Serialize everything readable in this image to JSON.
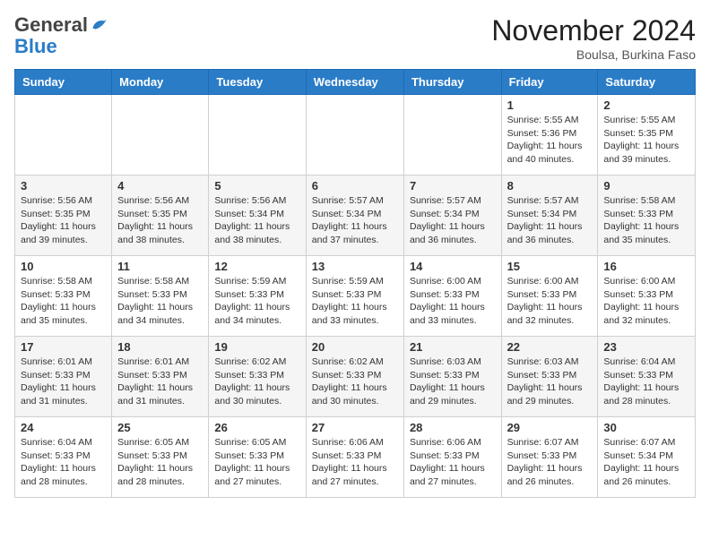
{
  "header": {
    "logo_general": "General",
    "logo_blue": "Blue",
    "month_title": "November 2024",
    "subtitle": "Boulsa, Burkina Faso"
  },
  "days_of_week": [
    "Sunday",
    "Monday",
    "Tuesday",
    "Wednesday",
    "Thursday",
    "Friday",
    "Saturday"
  ],
  "weeks": [
    [
      {
        "day": "",
        "info": ""
      },
      {
        "day": "",
        "info": ""
      },
      {
        "day": "",
        "info": ""
      },
      {
        "day": "",
        "info": ""
      },
      {
        "day": "",
        "info": ""
      },
      {
        "day": "1",
        "info": "Sunrise: 5:55 AM\nSunset: 5:36 PM\nDaylight: 11 hours and 40 minutes."
      },
      {
        "day": "2",
        "info": "Sunrise: 5:55 AM\nSunset: 5:35 PM\nDaylight: 11 hours and 39 minutes."
      }
    ],
    [
      {
        "day": "3",
        "info": "Sunrise: 5:56 AM\nSunset: 5:35 PM\nDaylight: 11 hours and 39 minutes."
      },
      {
        "day": "4",
        "info": "Sunrise: 5:56 AM\nSunset: 5:35 PM\nDaylight: 11 hours and 38 minutes."
      },
      {
        "day": "5",
        "info": "Sunrise: 5:56 AM\nSunset: 5:34 PM\nDaylight: 11 hours and 38 minutes."
      },
      {
        "day": "6",
        "info": "Sunrise: 5:57 AM\nSunset: 5:34 PM\nDaylight: 11 hours and 37 minutes."
      },
      {
        "day": "7",
        "info": "Sunrise: 5:57 AM\nSunset: 5:34 PM\nDaylight: 11 hours and 36 minutes."
      },
      {
        "day": "8",
        "info": "Sunrise: 5:57 AM\nSunset: 5:34 PM\nDaylight: 11 hours and 36 minutes."
      },
      {
        "day": "9",
        "info": "Sunrise: 5:58 AM\nSunset: 5:33 PM\nDaylight: 11 hours and 35 minutes."
      }
    ],
    [
      {
        "day": "10",
        "info": "Sunrise: 5:58 AM\nSunset: 5:33 PM\nDaylight: 11 hours and 35 minutes."
      },
      {
        "day": "11",
        "info": "Sunrise: 5:58 AM\nSunset: 5:33 PM\nDaylight: 11 hours and 34 minutes."
      },
      {
        "day": "12",
        "info": "Sunrise: 5:59 AM\nSunset: 5:33 PM\nDaylight: 11 hours and 34 minutes."
      },
      {
        "day": "13",
        "info": "Sunrise: 5:59 AM\nSunset: 5:33 PM\nDaylight: 11 hours and 33 minutes."
      },
      {
        "day": "14",
        "info": "Sunrise: 6:00 AM\nSunset: 5:33 PM\nDaylight: 11 hours and 33 minutes."
      },
      {
        "day": "15",
        "info": "Sunrise: 6:00 AM\nSunset: 5:33 PM\nDaylight: 11 hours and 32 minutes."
      },
      {
        "day": "16",
        "info": "Sunrise: 6:00 AM\nSunset: 5:33 PM\nDaylight: 11 hours and 32 minutes."
      }
    ],
    [
      {
        "day": "17",
        "info": "Sunrise: 6:01 AM\nSunset: 5:33 PM\nDaylight: 11 hours and 31 minutes."
      },
      {
        "day": "18",
        "info": "Sunrise: 6:01 AM\nSunset: 5:33 PM\nDaylight: 11 hours and 31 minutes."
      },
      {
        "day": "19",
        "info": "Sunrise: 6:02 AM\nSunset: 5:33 PM\nDaylight: 11 hours and 30 minutes."
      },
      {
        "day": "20",
        "info": "Sunrise: 6:02 AM\nSunset: 5:33 PM\nDaylight: 11 hours and 30 minutes."
      },
      {
        "day": "21",
        "info": "Sunrise: 6:03 AM\nSunset: 5:33 PM\nDaylight: 11 hours and 29 minutes."
      },
      {
        "day": "22",
        "info": "Sunrise: 6:03 AM\nSunset: 5:33 PM\nDaylight: 11 hours and 29 minutes."
      },
      {
        "day": "23",
        "info": "Sunrise: 6:04 AM\nSunset: 5:33 PM\nDaylight: 11 hours and 28 minutes."
      }
    ],
    [
      {
        "day": "24",
        "info": "Sunrise: 6:04 AM\nSunset: 5:33 PM\nDaylight: 11 hours and 28 minutes."
      },
      {
        "day": "25",
        "info": "Sunrise: 6:05 AM\nSunset: 5:33 PM\nDaylight: 11 hours and 28 minutes."
      },
      {
        "day": "26",
        "info": "Sunrise: 6:05 AM\nSunset: 5:33 PM\nDaylight: 11 hours and 27 minutes."
      },
      {
        "day": "27",
        "info": "Sunrise: 6:06 AM\nSunset: 5:33 PM\nDaylight: 11 hours and 27 minutes."
      },
      {
        "day": "28",
        "info": "Sunrise: 6:06 AM\nSunset: 5:33 PM\nDaylight: 11 hours and 27 minutes."
      },
      {
        "day": "29",
        "info": "Sunrise: 6:07 AM\nSunset: 5:33 PM\nDaylight: 11 hours and 26 minutes."
      },
      {
        "day": "30",
        "info": "Sunrise: 6:07 AM\nSunset: 5:34 PM\nDaylight: 11 hours and 26 minutes."
      }
    ]
  ]
}
